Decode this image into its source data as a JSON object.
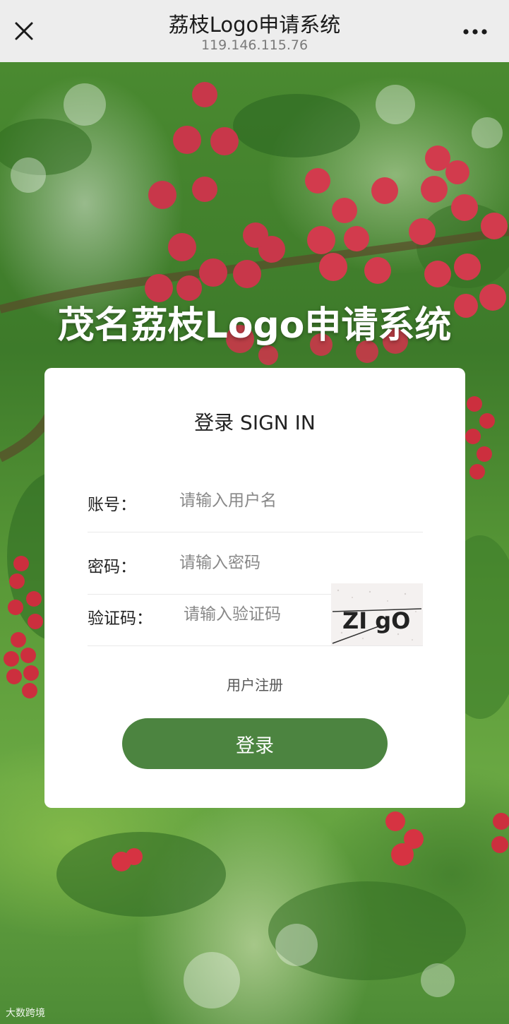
{
  "browser": {
    "title": "荔枝Logo申请系统",
    "url": "119.146.115.76"
  },
  "hero": {
    "title": "茂名荔枝Logo申请系统"
  },
  "login": {
    "title": "登录 SIGN IN",
    "username_label": "账号：",
    "username_placeholder": "请输入用户名",
    "password_label": "密码：",
    "password_placeholder": "请输入密码",
    "captcha_label": "验证码：",
    "captcha_placeholder": "请输入验证码",
    "captcha_text": "ZI gO",
    "register_link": "用户注册",
    "submit_label": "登录"
  },
  "watermark": "大数跨境",
  "colors": {
    "primary_button": "#4c8440",
    "card": "#ffffff",
    "topbar": "#ededed"
  },
  "icons": [
    "close-icon",
    "more-icon"
  ]
}
